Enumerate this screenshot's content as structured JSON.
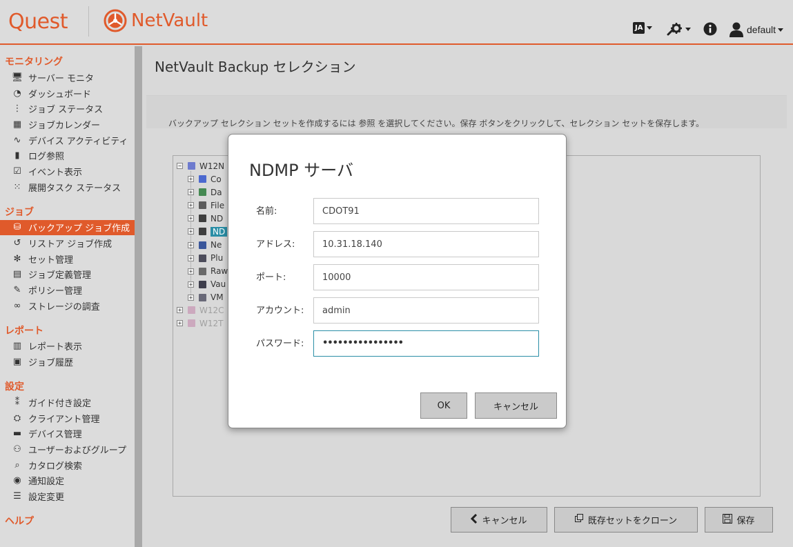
{
  "header": {
    "quest_logo": "Quest",
    "app_name": "NetVault",
    "lang_badge": "JA",
    "user": "default"
  },
  "sidebar": {
    "sections": [
      {
        "title": "モニタリング",
        "items": [
          {
            "label": "サーバー モニタ",
            "icon": "monitor-icon"
          },
          {
            "label": "ダッシュボード",
            "icon": "dashboard-icon"
          },
          {
            "label": "ジョブ ステータス",
            "icon": "job-status-icon"
          },
          {
            "label": "ジョブカレンダー",
            "icon": "calendar-icon"
          },
          {
            "label": "デバイス アクティビティ",
            "icon": "activity-icon"
          },
          {
            "label": "ログ参照",
            "icon": "log-icon"
          },
          {
            "label": "イベント表示",
            "icon": "event-icon"
          },
          {
            "label": "展開タスク ステータス",
            "icon": "deploy-status-icon"
          }
        ]
      },
      {
        "title": "ジョブ",
        "items": [
          {
            "label": "バックアップ ジョブ作成",
            "icon": "backup-job-icon",
            "active": true
          },
          {
            "label": "リストア ジョブ作成",
            "icon": "restore-job-icon"
          },
          {
            "label": "セット管理",
            "icon": "sets-icon"
          },
          {
            "label": "ジョブ定義管理",
            "icon": "job-definitions-icon"
          },
          {
            "label": "ポリシー管理",
            "icon": "policy-icon"
          },
          {
            "label": "ストレージの調査",
            "icon": "binoculars-icon"
          }
        ]
      },
      {
        "title": "レポート",
        "items": [
          {
            "label": "レポート表示",
            "icon": "report-icon"
          },
          {
            "label": "ジョブ履歴",
            "icon": "job-history-icon"
          }
        ]
      },
      {
        "title": "設定",
        "items": [
          {
            "label": "ガイド付き設定",
            "icon": "footsteps-icon"
          },
          {
            "label": "クライアント管理",
            "icon": "clients-icon"
          },
          {
            "label": "デバイス管理",
            "icon": "devices-icon"
          },
          {
            "label": "ユーザーおよびグループ",
            "icon": "users-icon"
          },
          {
            "label": "カタログ検索",
            "icon": "catalog-search-icon"
          },
          {
            "label": "通知設定",
            "icon": "notification-icon"
          },
          {
            "label": "設定変更",
            "icon": "settings-sliders-icon"
          }
        ]
      },
      {
        "title": "ヘルプ",
        "items": []
      }
    ]
  },
  "main": {
    "title": "NetVault Backup セレクション",
    "info": "バックアップ セレクション セットを作成するには 参照 を選択してください。保存 ボタンをクリックして、セレクション セットを保存します。",
    "tree": {
      "root": "W12N",
      "children": [
        "Co",
        "Da",
        "File",
        "ND",
        "ND",
        "Ne",
        "Plu",
        "Raw",
        "Vau",
        "VM"
      ],
      "others": [
        "W12C",
        "W12T"
      ]
    },
    "buttons": {
      "cancel": "キャンセル",
      "clone": "既存セットをクローン",
      "save": "保存"
    }
  },
  "modal": {
    "title": "NDMP サーバ",
    "fields": {
      "name_label": "名前:",
      "name_value": "CDOT91",
      "address_label": "アドレス:",
      "address_value": "10.31.18.140",
      "port_label": "ポート:",
      "port_value": "10000",
      "account_label": "アカウント:",
      "account_value": "admin",
      "password_label": "パスワード:",
      "password_mask": "••••••••••••••••"
    },
    "ok_label": "OK",
    "cancel_label": "キャンセル"
  },
  "colors": {
    "accent": "#e05a2b",
    "selection": "#2a8ea6"
  }
}
